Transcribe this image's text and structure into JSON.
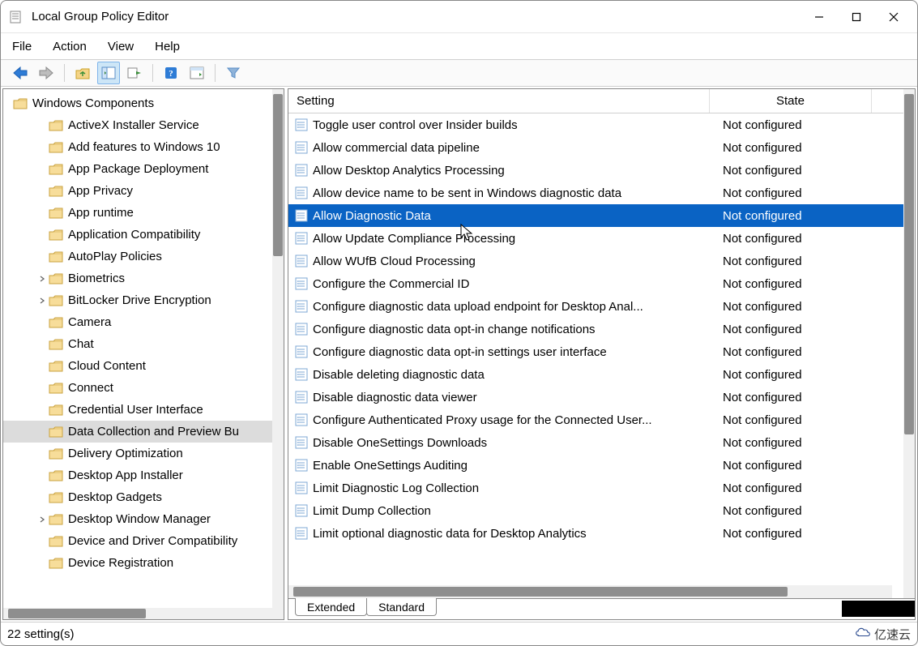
{
  "window": {
    "title": "Local Group Policy Editor"
  },
  "menu": {
    "file": "File",
    "action": "Action",
    "view": "View",
    "help": "Help"
  },
  "tree": {
    "root": "Windows Components",
    "items": [
      {
        "label": "ActiveX Installer Service",
        "expander": ""
      },
      {
        "label": "Add features to Windows 10",
        "expander": ""
      },
      {
        "label": "App Package Deployment",
        "expander": ""
      },
      {
        "label": "App Privacy",
        "expander": ""
      },
      {
        "label": "App runtime",
        "expander": ""
      },
      {
        "label": "Application Compatibility",
        "expander": ""
      },
      {
        "label": "AutoPlay Policies",
        "expander": ""
      },
      {
        "label": "Biometrics",
        "expander": ">"
      },
      {
        "label": "BitLocker Drive Encryption",
        "expander": ">"
      },
      {
        "label": "Camera",
        "expander": ""
      },
      {
        "label": "Chat",
        "expander": ""
      },
      {
        "label": "Cloud Content",
        "expander": ""
      },
      {
        "label": "Connect",
        "expander": ""
      },
      {
        "label": "Credential User Interface",
        "expander": ""
      },
      {
        "label": "Data Collection and Preview Bu",
        "expander": "",
        "selected": true
      },
      {
        "label": "Delivery Optimization",
        "expander": ""
      },
      {
        "label": "Desktop App Installer",
        "expander": ""
      },
      {
        "label": "Desktop Gadgets",
        "expander": ""
      },
      {
        "label": "Desktop Window Manager",
        "expander": ">"
      },
      {
        "label": "Device and Driver Compatibility",
        "expander": ""
      },
      {
        "label": "Device Registration",
        "expander": ""
      }
    ]
  },
  "grid": {
    "headers": {
      "setting": "Setting",
      "state": "State"
    },
    "rows": [
      {
        "name": "Toggle user control over Insider builds",
        "state": "Not configured"
      },
      {
        "name": "Allow commercial data pipeline",
        "state": "Not configured"
      },
      {
        "name": "Allow Desktop Analytics Processing",
        "state": "Not configured"
      },
      {
        "name": "Allow device name to be sent in Windows diagnostic data",
        "state": "Not configured"
      },
      {
        "name": "Allow Diagnostic Data",
        "state": "Not configured",
        "selected": true
      },
      {
        "name": "Allow Update Compliance Processing",
        "state": "Not configured"
      },
      {
        "name": "Allow WUfB Cloud Processing",
        "state": "Not configured"
      },
      {
        "name": "Configure the Commercial ID",
        "state": "Not configured"
      },
      {
        "name": "Configure diagnostic data upload endpoint for Desktop Anal...",
        "state": "Not configured"
      },
      {
        "name": "Configure diagnostic data opt-in change notifications",
        "state": "Not configured"
      },
      {
        "name": "Configure diagnostic data opt-in settings user interface",
        "state": "Not configured"
      },
      {
        "name": "Disable deleting diagnostic data",
        "state": "Not configured"
      },
      {
        "name": "Disable diagnostic data viewer",
        "state": "Not configured"
      },
      {
        "name": "Configure Authenticated Proxy usage for the Connected User...",
        "state": "Not configured"
      },
      {
        "name": "Disable OneSettings Downloads",
        "state": "Not configured"
      },
      {
        "name": "Enable OneSettings Auditing",
        "state": "Not configured"
      },
      {
        "name": "Limit Diagnostic Log Collection",
        "state": "Not configured"
      },
      {
        "name": "Limit Dump Collection",
        "state": "Not configured"
      },
      {
        "name": "Limit optional diagnostic data for Desktop Analytics",
        "state": "Not configured"
      }
    ]
  },
  "tabs": {
    "extended": "Extended",
    "standard": "Standard"
  },
  "status": {
    "count": "22 setting(s)",
    "watermark": "亿速云"
  }
}
